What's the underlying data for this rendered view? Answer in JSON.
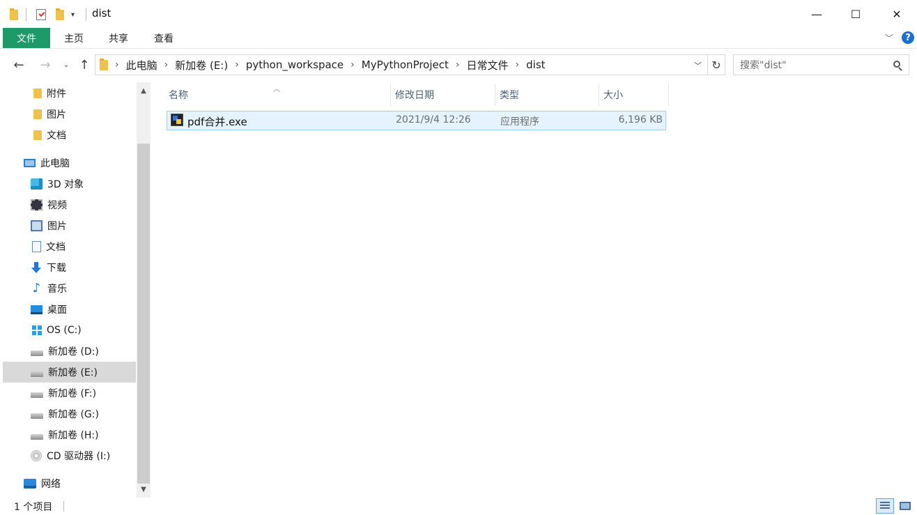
{
  "window": {
    "title": "dist",
    "controls": {
      "minimize": "—",
      "maximize": "☐",
      "close": "✕"
    }
  },
  "ribbon": {
    "tabs": [
      "文件",
      "主页",
      "共享",
      "查看"
    ],
    "help": "?"
  },
  "navigation": {
    "breadcrumbs": [
      "此电脑",
      "新加卷 (E:)",
      "python_workspace",
      "MyPythonProject",
      "日常文件",
      "dist"
    ],
    "search_placeholder": "搜索\"dist\""
  },
  "sidebar": {
    "quick_items": [
      {
        "label": "附件",
        "icon": "folder-icon"
      },
      {
        "label": "图片",
        "icon": "folder-icon"
      },
      {
        "label": "文档",
        "icon": "folder-icon"
      }
    ],
    "this_pc": "此电脑",
    "pc_items": [
      {
        "label": "3D 对象",
        "icon": "3d-objects-icon"
      },
      {
        "label": "视频",
        "icon": "video-icon"
      },
      {
        "label": "图片",
        "icon": "pictures-icon"
      },
      {
        "label": "文档",
        "icon": "documents-icon"
      },
      {
        "label": "下载",
        "icon": "download-icon"
      },
      {
        "label": "音乐",
        "icon": "music-icon"
      },
      {
        "label": "桌面",
        "icon": "desktop-icon"
      },
      {
        "label": "OS (C:)",
        "icon": "windows-drive-icon"
      },
      {
        "label": "新加卷 (D:)",
        "icon": "drive-icon"
      },
      {
        "label": "新加卷 (E:)",
        "icon": "drive-icon",
        "selected": true
      },
      {
        "label": "新加卷 (F:)",
        "icon": "drive-icon"
      },
      {
        "label": "新加卷 (G:)",
        "icon": "drive-icon"
      },
      {
        "label": "新加卷 (H:)",
        "icon": "drive-icon"
      },
      {
        "label": "CD 驱动器 (I:)",
        "icon": "cd-drive-icon"
      }
    ],
    "network": "网络"
  },
  "filelist": {
    "columns": [
      "名称",
      "修改日期",
      "类型",
      "大小"
    ],
    "files": [
      {
        "name": "pdf合并.exe",
        "modified": "2021/9/4 12:26",
        "type": "应用程序",
        "size": "6,196 KB"
      }
    ]
  },
  "status": {
    "item_count": "1 个项目"
  }
}
